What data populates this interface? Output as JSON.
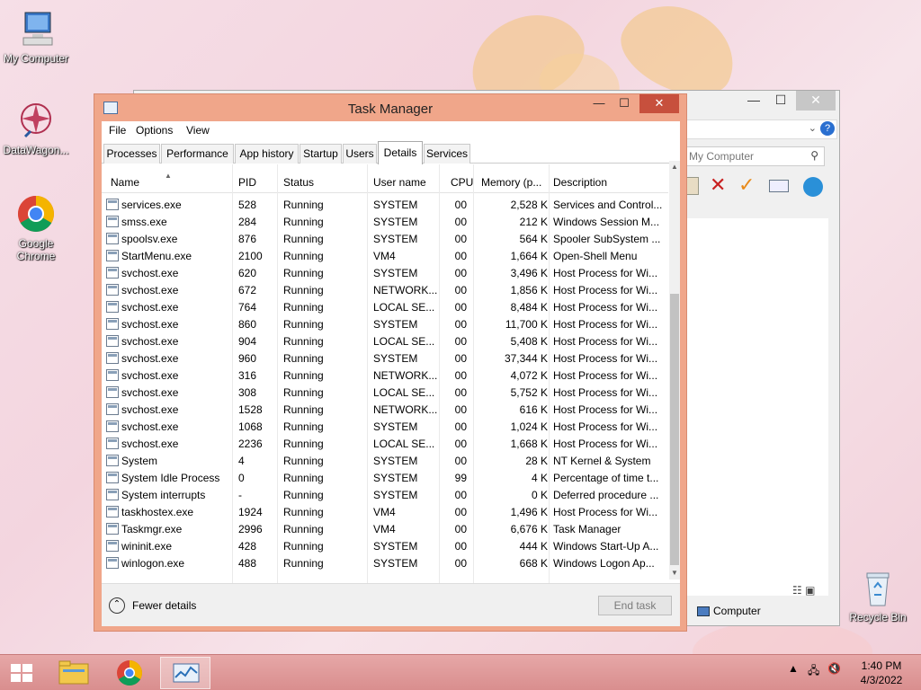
{
  "desktop": {
    "icons": [
      {
        "label": "My Computer"
      },
      {
        "label": "DataWagon..."
      },
      {
        "label": "Google Chrome"
      },
      {
        "label": "Recycle Bin"
      }
    ]
  },
  "explorer": {
    "search_placeholder": "My Computer",
    "status_item": "Computer",
    "minimize_glyph": "—",
    "maximize_glyph": "☐",
    "close_glyph": "✕"
  },
  "task_manager": {
    "title": "Task Manager",
    "minimize_glyph": "—",
    "maximize_glyph": "☐",
    "close_glyph": "✕",
    "menu": [
      "File",
      "Options",
      "View"
    ],
    "tabs": [
      "Processes",
      "Performance",
      "App history",
      "Startup",
      "Users",
      "Details",
      "Services"
    ],
    "active_tab": "Details",
    "columns": [
      "Name",
      "PID",
      "Status",
      "User name",
      "CPU",
      "Memory (p...",
      "Description"
    ],
    "rows": [
      [
        "services.exe",
        "528",
        "Running",
        "SYSTEM",
        "00",
        "2,528 K",
        "Services and Control..."
      ],
      [
        "smss.exe",
        "284",
        "Running",
        "SYSTEM",
        "00",
        "212 K",
        "Windows Session M..."
      ],
      [
        "spoolsv.exe",
        "876",
        "Running",
        "SYSTEM",
        "00",
        "564 K",
        "Spooler SubSystem ..."
      ],
      [
        "StartMenu.exe",
        "2100",
        "Running",
        "VM4",
        "00",
        "1,664 K",
        "Open-Shell Menu"
      ],
      [
        "svchost.exe",
        "620",
        "Running",
        "SYSTEM",
        "00",
        "3,496 K",
        "Host Process for Wi..."
      ],
      [
        "svchost.exe",
        "672",
        "Running",
        "NETWORK...",
        "00",
        "1,856 K",
        "Host Process for Wi..."
      ],
      [
        "svchost.exe",
        "764",
        "Running",
        "LOCAL SE...",
        "00",
        "8,484 K",
        "Host Process for Wi..."
      ],
      [
        "svchost.exe",
        "860",
        "Running",
        "SYSTEM",
        "00",
        "11,700 K",
        "Host Process for Wi..."
      ],
      [
        "svchost.exe",
        "904",
        "Running",
        "LOCAL SE...",
        "00",
        "5,408 K",
        "Host Process for Wi..."
      ],
      [
        "svchost.exe",
        "960",
        "Running",
        "SYSTEM",
        "00",
        "37,344 K",
        "Host Process for Wi..."
      ],
      [
        "svchost.exe",
        "316",
        "Running",
        "NETWORK...",
        "00",
        "4,072 K",
        "Host Process for Wi..."
      ],
      [
        "svchost.exe",
        "308",
        "Running",
        "LOCAL SE...",
        "00",
        "5,752 K",
        "Host Process for Wi..."
      ],
      [
        "svchost.exe",
        "1528",
        "Running",
        "NETWORK...",
        "00",
        "616 K",
        "Host Process for Wi..."
      ],
      [
        "svchost.exe",
        "1068",
        "Running",
        "SYSTEM",
        "00",
        "1,024 K",
        "Host Process for Wi..."
      ],
      [
        "svchost.exe",
        "2236",
        "Running",
        "LOCAL SE...",
        "00",
        "1,668 K",
        "Host Process for Wi..."
      ],
      [
        "System",
        "4",
        "Running",
        "SYSTEM",
        "00",
        "28 K",
        "NT Kernel & System"
      ],
      [
        "System Idle Process",
        "0",
        "Running",
        "SYSTEM",
        "99",
        "4 K",
        "Percentage of time t..."
      ],
      [
        "System interrupts",
        "-",
        "Running",
        "SYSTEM",
        "00",
        "0 K",
        "Deferred procedure ..."
      ],
      [
        "taskhostex.exe",
        "1924",
        "Running",
        "VM4",
        "00",
        "1,496 K",
        "Host Process for Wi..."
      ],
      [
        "Taskmgr.exe",
        "2996",
        "Running",
        "VM4",
        "00",
        "6,676 K",
        "Task Manager"
      ],
      [
        "wininit.exe",
        "428",
        "Running",
        "SYSTEM",
        "00",
        "444 K",
        "Windows Start-Up A..."
      ],
      [
        "winlogon.exe",
        "488",
        "Running",
        "SYSTEM",
        "00",
        "668 K",
        "Windows Logon Ap..."
      ]
    ],
    "fewer_details": "Fewer details",
    "end_task": "End task"
  },
  "taskbar": {
    "time": "1:40 PM",
    "date": "4/3/2022"
  },
  "colors": {
    "tm_frame": "#f0a68a",
    "close_red": "#c7503d",
    "taskbar": "#d98e8e"
  }
}
